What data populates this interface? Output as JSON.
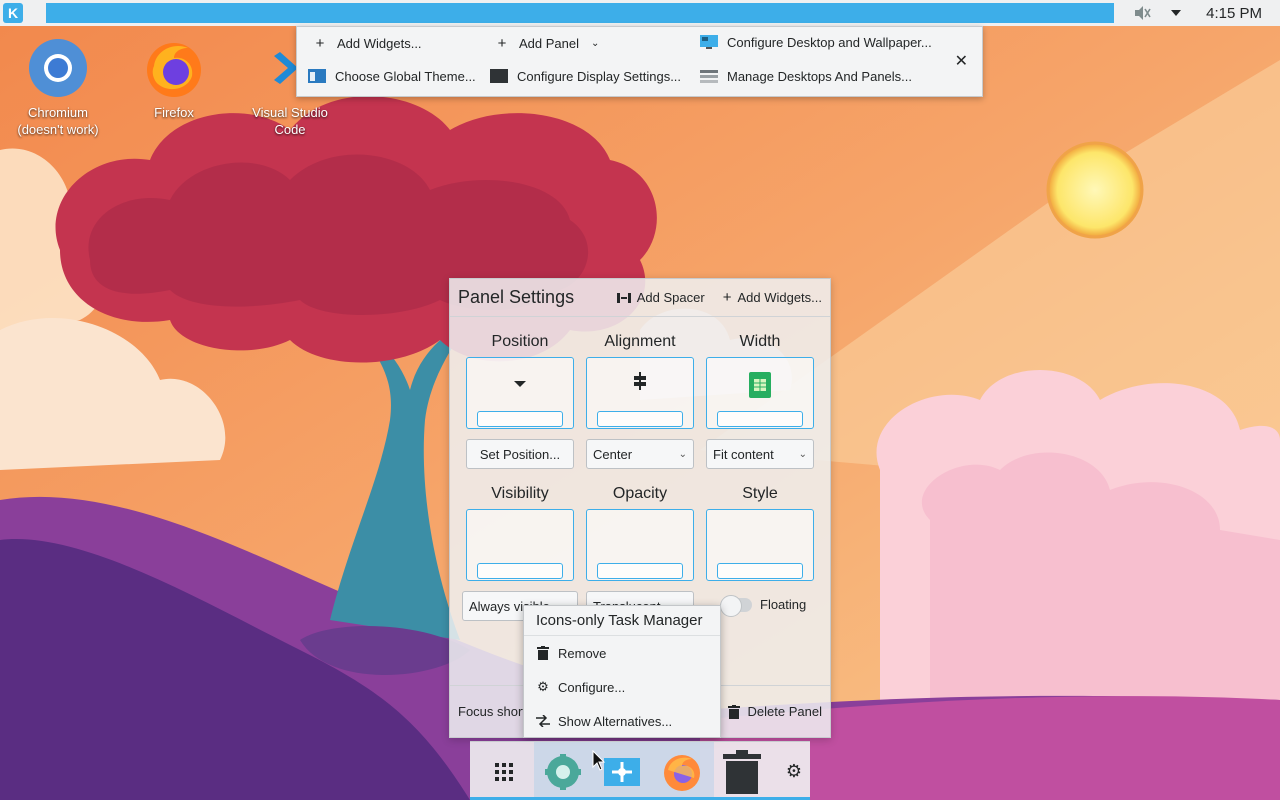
{
  "top_panel": {
    "clock": "4:15 PM"
  },
  "desktop_toolbox": {
    "add_widgets": "Add Widgets...",
    "add_panel": "Add Panel",
    "configure_desktop": "Configure Desktop and Wallpaper...",
    "choose_theme": "Choose Global Theme...",
    "configure_display": "Configure Display Settings...",
    "manage_desktops": "Manage Desktops And Panels..."
  },
  "desktop_icons": [
    {
      "label": "Chromium\n(doesn't work)"
    },
    {
      "label": "Firefox"
    },
    {
      "label": "Visual Studio\nCode"
    }
  ],
  "panel_settings": {
    "title": "Panel Settings",
    "add_spacer": "Add Spacer",
    "add_widgets": "Add Widgets...",
    "position": {
      "heading": "Position",
      "button": "Set Position..."
    },
    "alignment": {
      "heading": "Alignment",
      "value": "Center"
    },
    "width": {
      "heading": "Width",
      "value": "Fit content"
    },
    "visibility": {
      "heading": "Visibility",
      "value": "Always visible"
    },
    "opacity": {
      "heading": "Opacity",
      "value": "Translucent"
    },
    "style": {
      "heading": "Style",
      "floating": "Floating"
    },
    "focus_shortcut": "Focus shortcut",
    "delete_panel": "Delete Panel"
  },
  "context_menu": {
    "title": "Icons-only Task Manager",
    "remove": "Remove",
    "configure": "Configure...",
    "show_alternatives": "Show Alternatives..."
  },
  "colors": {
    "accent": "#3daee9",
    "panel_bg": "#eff0f1"
  }
}
